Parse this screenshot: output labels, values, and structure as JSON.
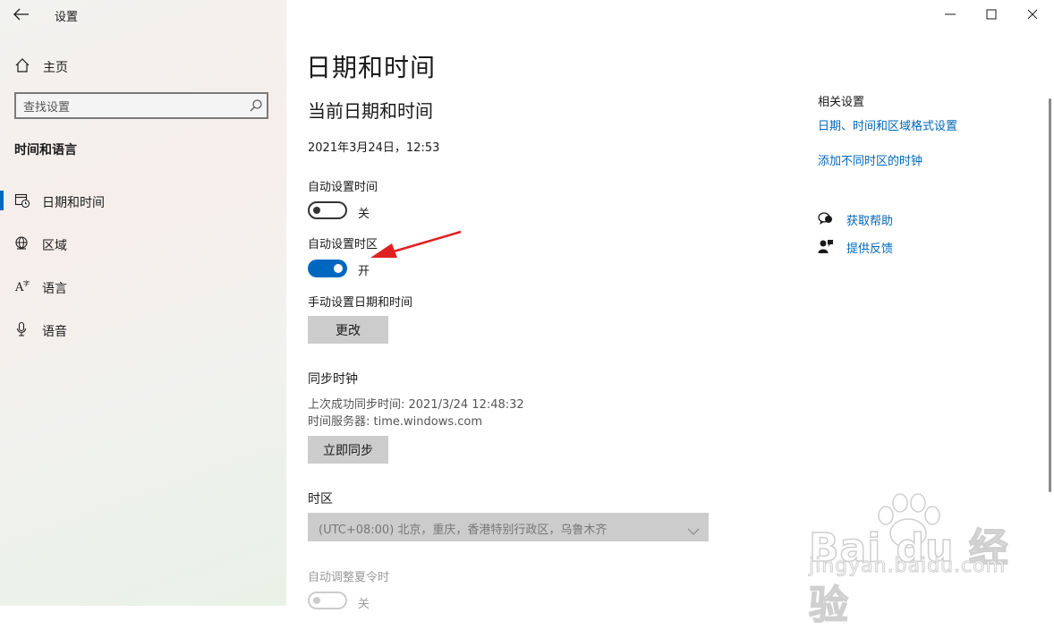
{
  "window": {
    "title": "设置"
  },
  "sidebar": {
    "home_label": "主页",
    "search_placeholder": "查找设置",
    "section_title": "时间和语言",
    "items": [
      {
        "label": "日期和时间",
        "icon": "calendar-clock-icon",
        "active": true
      },
      {
        "label": "区域",
        "icon": "globe-icon",
        "active": false
      },
      {
        "label": "语言",
        "icon": "language-icon",
        "active": false
      },
      {
        "label": "语音",
        "icon": "microphone-icon",
        "active": false
      }
    ]
  },
  "main": {
    "page_title": "日期和时间",
    "subtitle": "当前日期和时间",
    "current_datetime": "2021年3月24日，12:53",
    "auto_time": {
      "label": "自动设置时间",
      "state": "关",
      "on": false
    },
    "auto_timezone": {
      "label": "自动设置时区",
      "state": "开",
      "on": true
    },
    "manual": {
      "label": "手动设置日期和时间",
      "button": "更改"
    },
    "sync": {
      "title": "同步时钟",
      "last_sync": "上次成功同步时间: 2021/3/24 12:48:32",
      "server": "时间服务器: time.windows.com",
      "button": "立即同步"
    },
    "timezone": {
      "label": "时区",
      "value": "(UTC+08:00) 北京，重庆，香港特别行政区，乌鲁木齐"
    },
    "dst": {
      "label": "自动调整夏令时",
      "state": "关",
      "on": false
    }
  },
  "related": {
    "title": "相关设置",
    "links": [
      "日期、时间和区域格式设置",
      "添加不同时区的时钟"
    ],
    "help": "获取帮助",
    "feedback": "提供反馈"
  },
  "watermark": {
    "brand": "Bai du 经验",
    "url": "jingyan.baidu.com"
  },
  "colors": {
    "accent": "#0067c0",
    "link": "#0067b8",
    "annotation_arrow": "#e02020"
  }
}
